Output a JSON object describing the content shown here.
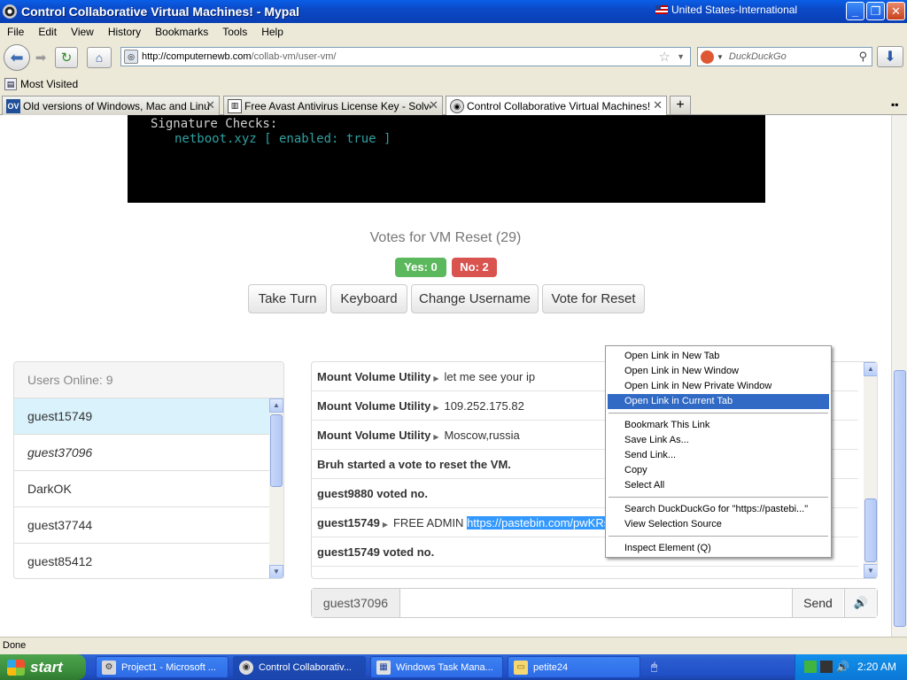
{
  "window": {
    "title": "Control Collaborative Virtual Machines! - Mypal",
    "locale": "United States-International"
  },
  "menu": [
    "File",
    "Edit",
    "View",
    "History",
    "Bookmarks",
    "Tools",
    "Help"
  ],
  "url": {
    "host": "http://computernewb.com",
    "path": "/collab-vm/user-vm/"
  },
  "search": {
    "placeholder": "DuckDuckGo"
  },
  "bookmarks": {
    "most_visited": "Most Visited"
  },
  "tabs": [
    {
      "label": "Old versions of Windows, Mac and Linux ..."
    },
    {
      "label": "Free Avast Antivirus License Key - Solve ..."
    },
    {
      "label": "Control Collaborative Virtual Machines!"
    }
  ],
  "vm": {
    "line1": "Signature Checks:",
    "line2": "netboot.xyz [ enabled: true ]"
  },
  "votes": {
    "title": "Votes for VM Reset (29)",
    "yes": "Yes: 0",
    "no": "No: 2"
  },
  "buttons": {
    "take_turn": "Take Turn",
    "keyboard": "Keyboard",
    "change_username": "Change Username",
    "vote_reset": "Vote for Reset"
  },
  "users": {
    "header": "Users Online: 9",
    "list": [
      "guest15749",
      "guest37096",
      "DarkOK",
      "guest37744",
      "guest85412"
    ]
  },
  "chat": {
    "messages": [
      {
        "user": "Mount Volume Utility",
        "text": "let me see your ip"
      },
      {
        "user": "Mount Volume Utility",
        "text": "109.252.175.82"
      },
      {
        "user": "Mount Volume Utility",
        "text": "Moscow,russia"
      },
      {
        "system": "Bruh started a vote to reset the VM."
      },
      {
        "system": "guest9880 voted no."
      },
      {
        "user": "guest15749",
        "text": "FREE ADMIN",
        "link": "https://pastebin.com/pwKRs"
      },
      {
        "system": "guest15749 voted no."
      }
    ],
    "username": "guest37096",
    "send": "Send"
  },
  "context_menu": {
    "items": [
      "Open Link in New Tab",
      "Open Link in New Window",
      "Open Link in New Private Window",
      "Open Link in Current Tab",
      "Bookmark This Link",
      "Save Link As...",
      "Send Link...",
      "Copy",
      "Select All",
      "Search DuckDuckGo for \"https://pastebi...\"",
      "View Selection Source",
      "Inspect Element (Q)"
    ],
    "highlighted": "Open Link in Current Tab"
  },
  "status": "Done",
  "taskbar": {
    "start": "start",
    "tasks": [
      "Project1 - Microsoft ...",
      "Control Collaborativ...",
      "Windows Task Mana...",
      "petite24"
    ],
    "clock": "2:20 AM"
  },
  "colors": {
    "title_blue": "#0B49C6",
    "yes_green": "#5cb85c",
    "no_red": "#d9534f",
    "menu_highlight": "#316ac5",
    "taskbar_blue": "#2150c6"
  }
}
